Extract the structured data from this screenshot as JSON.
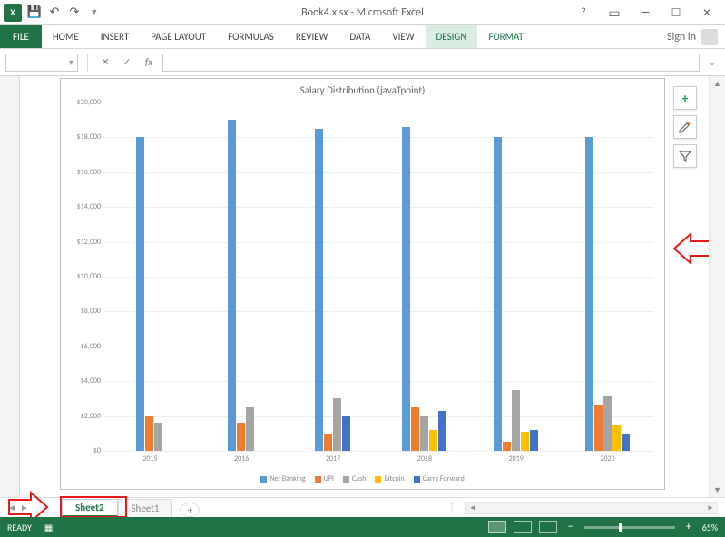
{
  "app": {
    "title": "Book4.xlsx - Microsoft Excel",
    "signin_label": "Sign in"
  },
  "qat": {
    "save_tip": "Save",
    "undo_tip": "Undo",
    "redo_tip": "Redo"
  },
  "ribbon": {
    "file": "FILE",
    "tabs": [
      "HOME",
      "INSERT",
      "PAGE LAYOUT",
      "FORMULAS",
      "REVIEW",
      "DATA",
      "VIEW"
    ],
    "tool_tabs": [
      "DESIGN",
      "FORMAT"
    ],
    "active_tool_tab": 0
  },
  "formula_bar": {
    "name_box": "",
    "cancel": "✕",
    "enter": "✓",
    "fx": "fx",
    "value": ""
  },
  "sheets": {
    "active": "Sheet2",
    "tabs": [
      "Sheet2",
      "Sheet1"
    ],
    "add_label": "+"
  },
  "status": {
    "ready": "READY",
    "zoom": "65%"
  },
  "chart_buttons": {
    "add": "+",
    "style": "✎",
    "filter": "▾"
  },
  "chart_data": {
    "type": "bar",
    "title": "Salary Distribution (javaTpoint)",
    "categories": [
      "2015",
      "2016",
      "2017",
      "2018",
      "2019",
      "2020"
    ],
    "series": [
      {
        "name": "Net Banking",
        "color": "#5b9bd5",
        "values": [
          18000,
          19000,
          18500,
          18600,
          18000,
          18000
        ]
      },
      {
        "name": "UPI",
        "color": "#ed7d31",
        "values": [
          2000,
          1600,
          1000,
          2500,
          500,
          2600
        ]
      },
      {
        "name": "Cash",
        "color": "#a5a5a5",
        "values": [
          1600,
          2500,
          3000,
          2000,
          3500,
          3100
        ]
      },
      {
        "name": "Bitcoin",
        "color": "#ffc000",
        "values": [
          0,
          0,
          0,
          1200,
          1100,
          1500
        ]
      },
      {
        "name": "Carry Forward",
        "color": "#4472c4",
        "values": [
          0,
          0,
          2000,
          2300,
          1200,
          1000
        ]
      }
    ],
    "ylabel": "",
    "xlabel": "",
    "ylim": [
      0,
      20000
    ],
    "yticks": [
      "$0",
      "$2,000",
      "$4,000",
      "$6,000",
      "$8,000",
      "$10,000",
      "$12,000",
      "$14,000",
      "$16,000",
      "$18,000",
      "$20,000"
    ]
  }
}
